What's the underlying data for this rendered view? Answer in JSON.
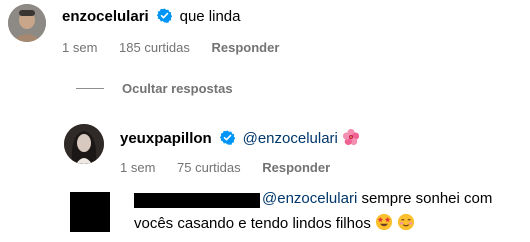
{
  "comment1": {
    "username": "enzocelulari",
    "text": "que linda",
    "time": "1 sem",
    "likes": "185 curtidas",
    "reply_label": "Responder"
  },
  "hide_replies_label": "Ocultar respostas",
  "reply1": {
    "username": "yeuxpapillon",
    "mention": "@enzocelulari",
    "emoji": "hibiscus-icon",
    "time": "1 sem",
    "likes": "75 curtidas",
    "reply_label": "Responder"
  },
  "reply2": {
    "mention": "@enzocelulari",
    "text_line1": " sempre sonhei com",
    "text_line2": "vocês casando e tendo lindos filhos",
    "emojis": [
      "star-struck-icon",
      "blushing-face-icon"
    ]
  },
  "colors": {
    "verified_blue": "#0095f6",
    "meta_gray": "#737373",
    "mention_blue": "#00376b"
  }
}
